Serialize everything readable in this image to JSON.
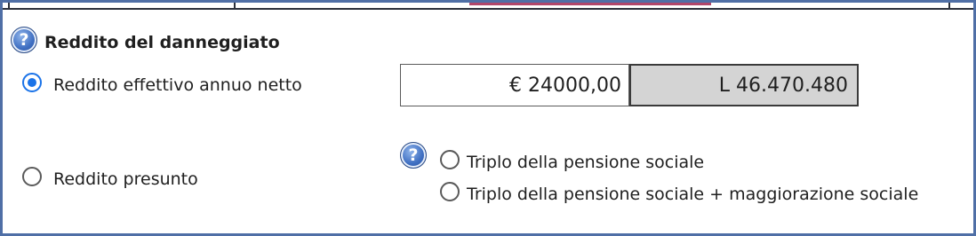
{
  "section": {
    "title": "Reddito del danneggiato",
    "help_icon": "question-mark-circle-icon"
  },
  "income_mode": {
    "selected": "effective",
    "effective": {
      "label": "Reddito effettivo annuo netto",
      "checked": true,
      "euro_value": "€ 24000,00",
      "lire_value": "L 46.470.480"
    },
    "presumed": {
      "label": "Reddito presunto",
      "checked": false,
      "help_icon": "question-mark-circle-icon",
      "options": [
        {
          "label": "Triplo della pensione sociale",
          "checked": false
        },
        {
          "label": "Triplo della pensione sociale + maggiorazione sociale",
          "checked": false
        }
      ]
    }
  },
  "colors": {
    "frame_border": "#4f6fa6",
    "radio_selected": "#1a73e8",
    "readonly_field_bg": "#d4d4d4",
    "help_icon_blue": "#3f6fc2"
  }
}
